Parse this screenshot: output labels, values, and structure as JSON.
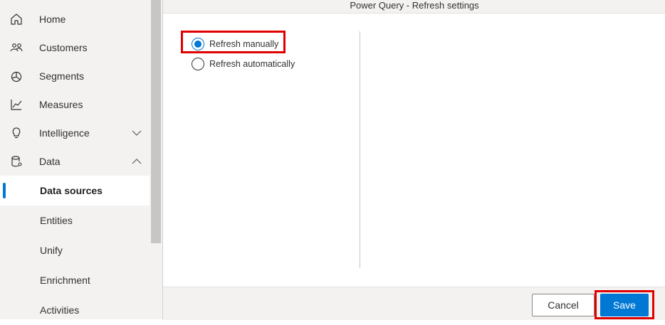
{
  "sidebar": {
    "items": [
      {
        "label": "Home",
        "icon": "home-icon"
      },
      {
        "label": "Customers",
        "icon": "customers-icon"
      },
      {
        "label": "Segments",
        "icon": "segments-icon"
      },
      {
        "label": "Measures",
        "icon": "measures-icon"
      },
      {
        "label": "Intelligence",
        "icon": "lightbulb-icon",
        "chevron": "chevron-down-icon"
      },
      {
        "label": "Data",
        "icon": "data-icon",
        "chevron": "chevron-up-icon"
      }
    ],
    "subitems": [
      {
        "label": "Data sources",
        "selected": true
      },
      {
        "label": "Entities"
      },
      {
        "label": "Unify"
      },
      {
        "label": "Enrichment"
      },
      {
        "label": "Activities"
      }
    ]
  },
  "dialog": {
    "title": "Power Query - Refresh settings",
    "options": [
      {
        "label": "Refresh manually",
        "checked": true
      },
      {
        "label": "Refresh automatically",
        "checked": false
      }
    ],
    "cancel_label": "Cancel",
    "save_label": "Save"
  },
  "colors": {
    "accent": "#0078d4",
    "highlight": "#e00000",
    "sidebar_bg": "#f3f2f1"
  }
}
